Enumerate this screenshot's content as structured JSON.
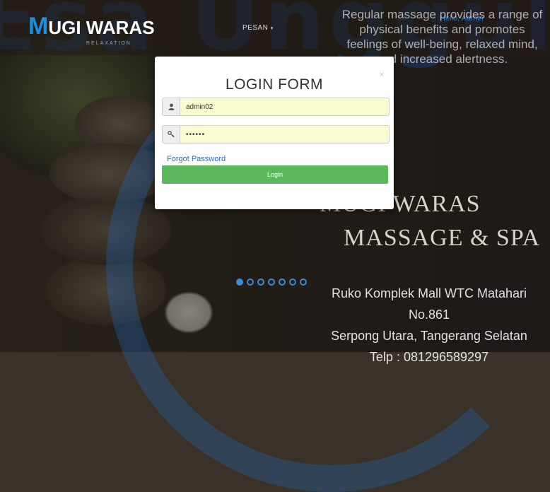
{
  "watermark": "Esa Unggul",
  "nav": {
    "brand_m": "M",
    "brand_rest": "UGI WARAS",
    "brand_sub": "RELAXATION",
    "pesan": "PESAN",
    "right_link": "Hello, Admin"
  },
  "hero": {
    "top_text": "Regular massage provides a range of physical benefits and promotes feelings of well-being, relaxed mind, and increased alertness.",
    "title1": "MUGI WARAS",
    "title2": "MASSAGE & SPA",
    "address_line1": "Ruko Komplek Mall WTC Matahari No.861",
    "address_line2": "Serpong Utara, Tangerang Selatan",
    "phone": "Telp : 081296589297",
    "slide_count": 7,
    "active_slide": 0
  },
  "modal": {
    "close": "×",
    "title": "LOGIN FORM",
    "username_value": "admin02",
    "password_value": "••••••",
    "user_icon": "user-icon",
    "key_icon": "key-icon",
    "forgot": "Forgot Password",
    "login": "Login"
  },
  "colors": {
    "accent": "#1d8fe0",
    "login_button": "#5cb85c",
    "input_fill": "#fbfbd0"
  }
}
